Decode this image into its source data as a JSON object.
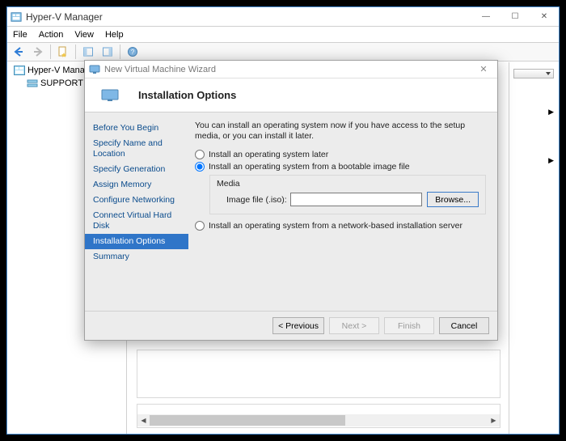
{
  "window": {
    "title": "Hyper-V Manager",
    "minimize_tip": "Minimize",
    "maximize_tip": "Maximize",
    "close_tip": "Close"
  },
  "menu": {
    "file": "File",
    "action": "Action",
    "view": "View",
    "help": "Help"
  },
  "tree": {
    "root": "Hyper-V Manager",
    "host": "SUPPORT"
  },
  "wizard": {
    "title": "New Virtual Machine Wizard",
    "headline": "Installation Options",
    "steps": [
      "Before You Begin",
      "Specify Name and Location",
      "Specify Generation",
      "Assign Memory",
      "Configure Networking",
      "Connect Virtual Hard Disk",
      "Installation Options",
      "Summary"
    ],
    "selected_step_index": 6,
    "intro": "You can install an operating system now if you have access to the setup media, or you can install it later.",
    "opt_later": "Install an operating system later",
    "opt_image": "Install an operating system from a bootable image file",
    "opt_network": "Install an operating system from a network-based installation server",
    "selected_option": "image",
    "media_legend": "Media",
    "image_label": "Image file (.iso):",
    "image_value": "",
    "browse": "Browse...",
    "buttons": {
      "prev": "< Previous",
      "next": "Next >",
      "finish": "Finish",
      "cancel": "Cancel"
    }
  }
}
